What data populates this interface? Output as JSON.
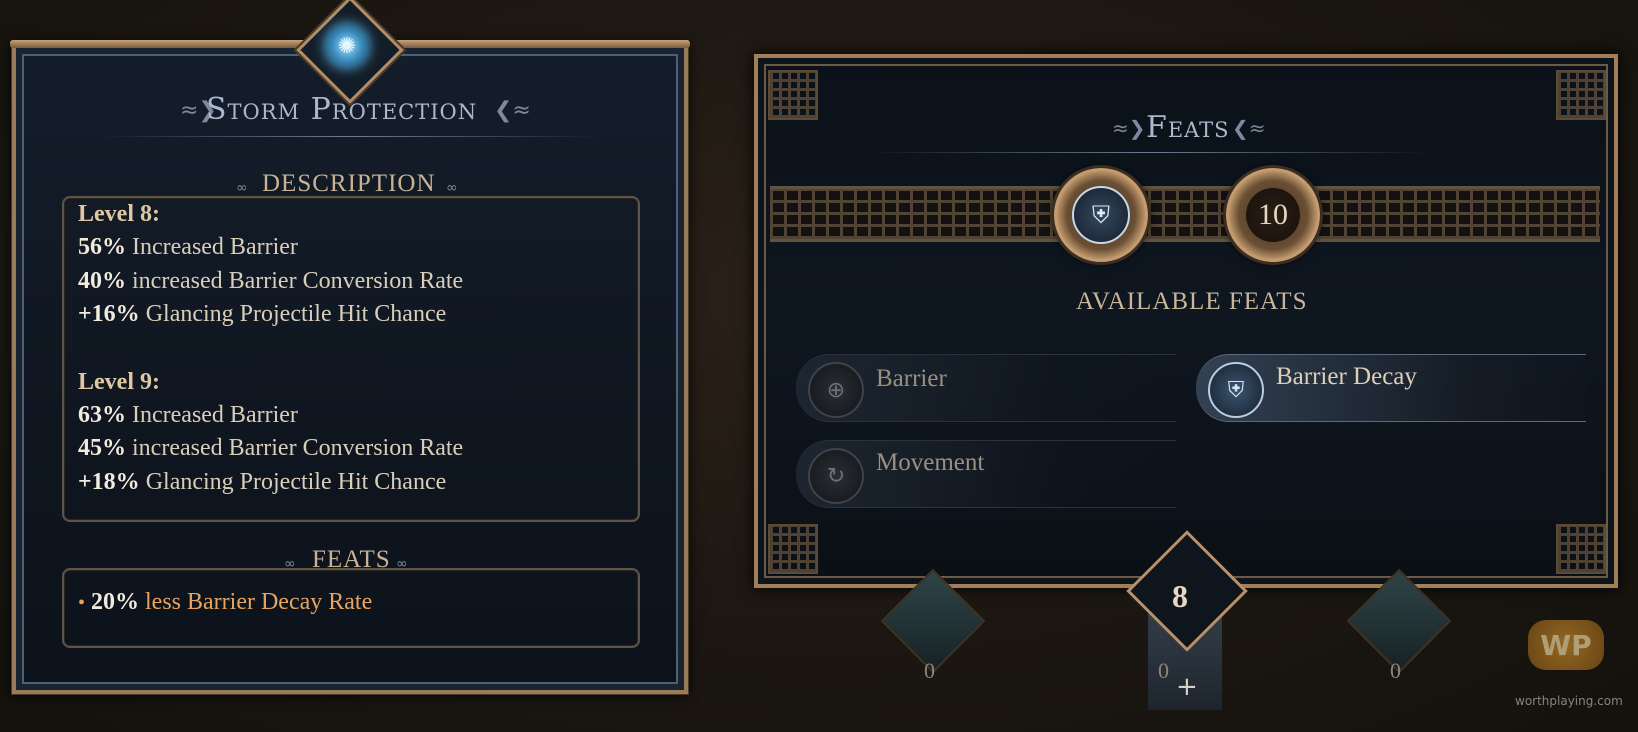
{
  "storm_panel": {
    "title": "Storm Protection",
    "gem_icon": "storm-rune-icon",
    "description_label": "DESCRIPTION",
    "levels": [
      {
        "label": "Level 8:",
        "stats": [
          {
            "value": "56%",
            "text": " Increased Barrier"
          },
          {
            "value": "40%",
            "text": " increased Barrier Conversion Rate"
          },
          {
            "value": "+16%",
            "text": " Glancing Projectile Hit Chance"
          }
        ]
      },
      {
        "label": "Level 9:",
        "stats": [
          {
            "value": "63%",
            "text": " Increased Barrier"
          },
          {
            "value": "45%",
            "text": " increased Barrier Conversion Rate"
          },
          {
            "value": "+18%",
            "text": " Glancing Projectile Hit Chance"
          }
        ]
      }
    ],
    "feats_label": "FEATS",
    "feat_bonus": {
      "bullet": "•",
      "value": "20%",
      "text": " less Barrier Decay Rate",
      "color": "#e8a35f"
    }
  },
  "feats_panel": {
    "title": "Feats",
    "selected_feat_icon": "barrier-decay-icon",
    "points": "10",
    "available_label": "AVAILABLE FEATS",
    "feats": [
      {
        "name": "Barrier",
        "icon": "barrier-icon",
        "active": false
      },
      {
        "name": "Barrier Decay",
        "icon": "barrier-decay-icon",
        "active": true
      },
      {
        "name": "Movement",
        "icon": "movement-icon",
        "active": false
      }
    ]
  },
  "skill_bar": {
    "current_level": "8",
    "counters": [
      "0",
      "0",
      "0"
    ],
    "add_symbol": "+"
  },
  "watermark": {
    "logo_text": "WP",
    "site": "worthplaying.com"
  },
  "colors": {
    "gold_frame": "#9a7b57",
    "panel_bg": "#0f1620",
    "accent_orange": "#e8a35f",
    "title_blue": "#a9b8cc"
  }
}
